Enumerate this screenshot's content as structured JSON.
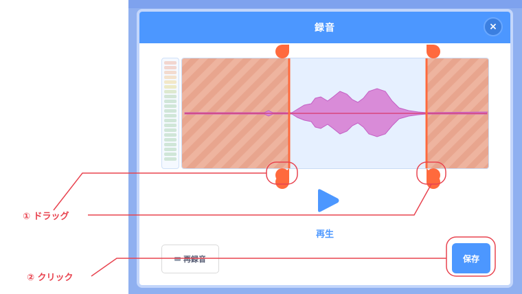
{
  "dialog": {
    "title": "録音",
    "close_icon": "×"
  },
  "player": {
    "play_label": "再生"
  },
  "buttons": {
    "rerecord_label": "再録音",
    "save_label": "保存"
  },
  "annotations": {
    "drag_label": "① ドラッグ",
    "click_label": "② クリック"
  },
  "colors": {
    "accent": "#4c97ff",
    "trim_handle": "#ff6a3d",
    "waveform": "#d98bd8",
    "annotation": "#e8434f"
  }
}
